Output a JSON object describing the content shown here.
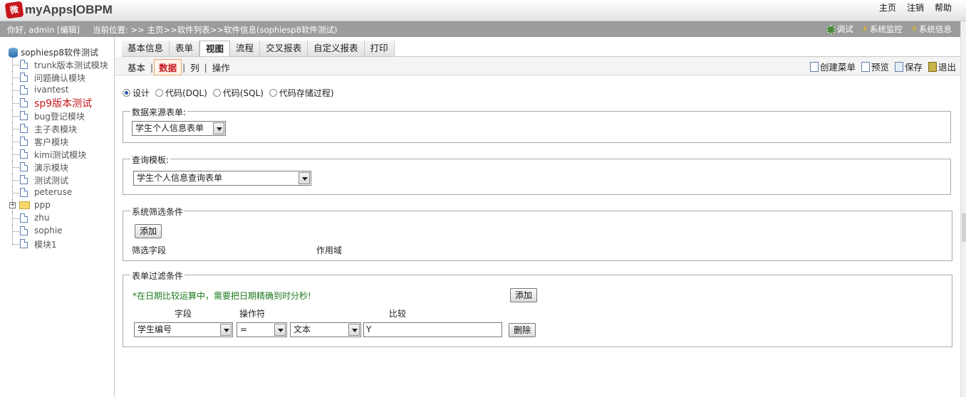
{
  "app": {
    "logo_badge": "微",
    "logo_name": "myApps",
    "logo_product": "OBPM"
  },
  "top_links": [
    "主页",
    "注销",
    "帮助"
  ],
  "status": {
    "greeting": "你好, admin [编辑]",
    "location": "当前位置: >> 主页>>软件列表>>软件信息(sophiesp8软件测试)",
    "tools": [
      {
        "label": "调试",
        "icon": "gear-icon"
      },
      {
        "label": "系统监控",
        "icon": "bolt-icon"
      },
      {
        "label": "系统信息",
        "icon": "bolt-icon"
      }
    ]
  },
  "tree": {
    "root": "sophiesp8软件测试",
    "items": [
      {
        "label": "trunk版本测试模块",
        "type": "doc"
      },
      {
        "label": "问题确认模块",
        "type": "doc"
      },
      {
        "label": "ivantest",
        "type": "doc"
      },
      {
        "label": "sp9版本测试",
        "type": "doc",
        "active": true
      },
      {
        "label": "bug登记模块",
        "type": "doc"
      },
      {
        "label": "主子表模块",
        "type": "doc"
      },
      {
        "label": "客户模块",
        "type": "doc"
      },
      {
        "label": "kimi测试模块",
        "type": "doc"
      },
      {
        "label": "演示模块",
        "type": "doc"
      },
      {
        "label": "测试测试",
        "type": "doc"
      },
      {
        "label": "peteruse",
        "type": "doc"
      },
      {
        "label": "ppp",
        "type": "folder"
      },
      {
        "label": "zhu",
        "type": "doc"
      },
      {
        "label": "sophie",
        "type": "doc"
      },
      {
        "label": "模块1",
        "type": "doc"
      }
    ]
  },
  "tabs": [
    "基本信息",
    "表单",
    "视图",
    "流程",
    "交叉报表",
    "自定义报表",
    "打印"
  ],
  "active_tab": "视图",
  "subtabs": [
    "基本",
    "数据",
    "列",
    "操作"
  ],
  "active_subtab": "数据",
  "actions": [
    {
      "label": "创建菜单",
      "icon": "new-menu-icon"
    },
    {
      "label": "预览",
      "icon": "preview-icon"
    },
    {
      "label": "保存",
      "icon": "save-icon"
    },
    {
      "label": "退出",
      "icon": "exit-icon"
    }
  ],
  "modes": {
    "options": [
      "设计",
      "代码(DQL)",
      "代码(SQL)",
      "代码存储过程)"
    ],
    "selected": "设计"
  },
  "source_form": {
    "legend": "数据来源表单:",
    "value": "学生个人信息表单"
  },
  "query_template": {
    "legend": "查询模板:",
    "value": "学生个人信息查询表单"
  },
  "system_filter": {
    "legend": "系统筛选条件",
    "add_label": "添加",
    "col_field": "筛选字段",
    "col_scope": "作用域"
  },
  "form_filter": {
    "legend": "表单过滤条件",
    "note": "*在日期比较运算中，需要把日期精确到时分秒!",
    "add_label": "添加",
    "col_field": "字段",
    "col_operator": "操作符",
    "col_compare": "比较",
    "row": {
      "field": "学生编号",
      "operator": "=",
      "type": "文本",
      "value": "Y",
      "delete_label": "删除"
    }
  }
}
